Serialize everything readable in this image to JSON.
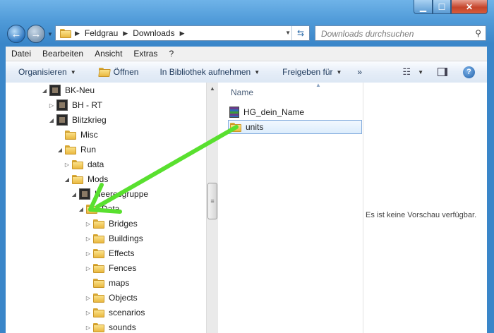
{
  "address": {
    "segments": [
      "Feldgrau",
      "Downloads"
    ]
  },
  "search": {
    "placeholder": "Downloads durchsuchen"
  },
  "menu": [
    "Datei",
    "Bearbeiten",
    "Ansicht",
    "Extras",
    "?"
  ],
  "toolbar": {
    "organize": "Organisieren",
    "open": "Öffnen",
    "library": "In Bibliothek aufnehmen",
    "share": "Freigeben für",
    "more": "»"
  },
  "tree": [
    {
      "label": "BK-Neu",
      "icon": "app-icon",
      "triangle": "open"
    },
    {
      "label": "BH - RT",
      "icon": "app-icon",
      "triangle": "closed"
    },
    {
      "label": "Blitzkrieg",
      "icon": "app-icon",
      "triangle": "open"
    },
    {
      "label": "Misc",
      "icon": "folder-icon",
      "triangle": "none"
    },
    {
      "label": "Run",
      "icon": "folder-icon",
      "triangle": "open"
    },
    {
      "label": "data",
      "icon": "folder-icon",
      "triangle": "closed"
    },
    {
      "label": "Mods",
      "icon": "folder-icon",
      "triangle": "open"
    },
    {
      "label": "Heeresgruppe",
      "icon": "app-icon",
      "triangle": "open"
    },
    {
      "label": "Data",
      "icon": "folder-icon",
      "triangle": "open"
    },
    {
      "label": "Bridges",
      "icon": "folder-icon",
      "triangle": "closed"
    },
    {
      "label": "Buildings",
      "icon": "folder-icon",
      "triangle": "closed"
    },
    {
      "label": "Effects",
      "icon": "folder-icon",
      "triangle": "closed"
    },
    {
      "label": "Fences",
      "icon": "folder-icon",
      "triangle": "closed"
    },
    {
      "label": "maps",
      "icon": "folder-icon",
      "triangle": "none"
    },
    {
      "label": "Objects",
      "icon": "folder-icon",
      "triangle": "closed"
    },
    {
      "label": "scenarios",
      "icon": "folder-icon",
      "triangle": "closed"
    },
    {
      "label": "sounds",
      "icon": "folder-icon",
      "triangle": "closed"
    }
  ],
  "content": {
    "column": "Name",
    "files": [
      {
        "name": "HG_dein_Name",
        "icon": "rar-archive-icon",
        "selected": false
      },
      {
        "name": "units",
        "icon": "folder-icon",
        "selected": true
      }
    ]
  },
  "preview": {
    "message": "Es ist keine Vorschau verfügbar."
  },
  "colors": {
    "annotation_arrow": "#59e02f",
    "frame": "#3a86c9",
    "selection_border": "#84acdd"
  }
}
